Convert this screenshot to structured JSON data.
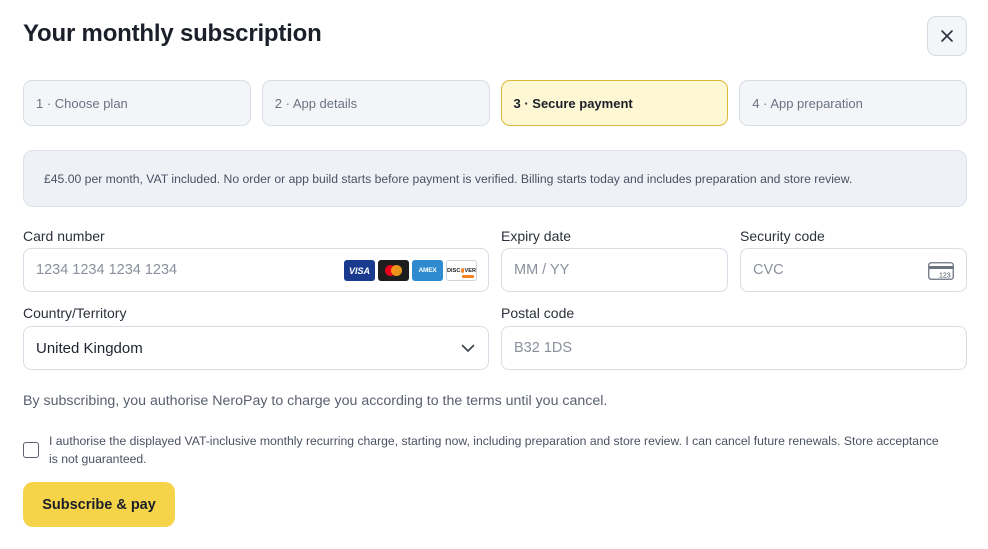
{
  "header": {
    "title": "Your monthly subscription",
    "close_icon": "close-icon"
  },
  "steps": [
    {
      "label": "1 · Choose plan",
      "active": false
    },
    {
      "label": "2 · App details",
      "active": false
    },
    {
      "label": "3 · Secure payment",
      "active": true
    },
    {
      "label": "4 · App preparation",
      "active": false
    }
  ],
  "notice": "£45.00 per month, VAT included. No order or app build starts before payment is verified. Billing starts today and includes preparation and store review.",
  "form": {
    "card_number": {
      "label": "Card number",
      "placeholder": "1234 1234 1234 1234",
      "value": "",
      "brands": [
        "VISA",
        "Mastercard",
        "AMEX",
        "DISCOVER"
      ]
    },
    "expiry": {
      "label": "Expiry date",
      "placeholder": "MM / YY",
      "value": ""
    },
    "security_code": {
      "label": "Security code",
      "placeholder": "CVC",
      "value": "",
      "icon": "card-cvc-icon",
      "icon_text": "123"
    },
    "country": {
      "label": "Country/Territory",
      "value": "United Kingdom",
      "icon": "chevron-down-icon"
    },
    "postal_code": {
      "label": "Postal code",
      "placeholder": "B32 1DS",
      "value": ""
    }
  },
  "consent_text": "By subscribing, you authorise NeroPay to charge you according to the terms until you cancel.",
  "authorisation": {
    "checked": false,
    "text": "I authorise the displayed VAT-inclusive monthly recurring charge, starting now, including preparation and store review. I can cancel future renewals. Store acceptance is not guaranteed."
  },
  "submit_label": "Subscribe & pay",
  "colors": {
    "accent": "#f6d449",
    "active_step_bg": "#fdf7d3",
    "active_step_border": "#d9b93a",
    "notice_bg": "#eef1f6"
  }
}
